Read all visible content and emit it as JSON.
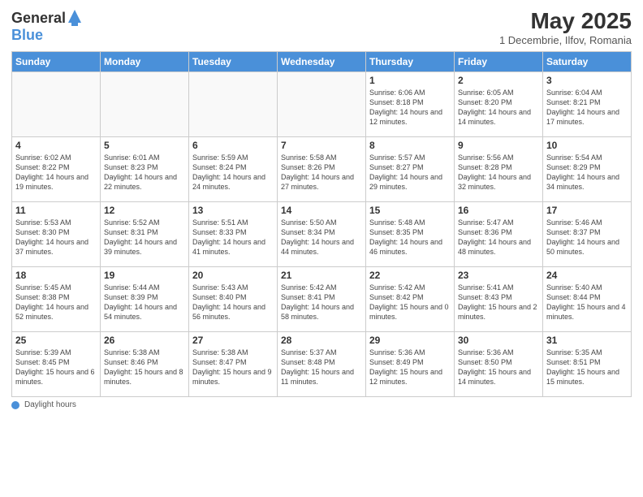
{
  "header": {
    "logo_general": "General",
    "logo_blue": "Blue",
    "month_title": "May 2025",
    "subtitle": "1 Decembrie, Ilfov, Romania"
  },
  "footer": {
    "label": "Daylight hours"
  },
  "columns": [
    "Sunday",
    "Monday",
    "Tuesday",
    "Wednesday",
    "Thursday",
    "Friday",
    "Saturday"
  ],
  "rows": [
    [
      {
        "day": "",
        "info": ""
      },
      {
        "day": "",
        "info": ""
      },
      {
        "day": "",
        "info": ""
      },
      {
        "day": "",
        "info": ""
      },
      {
        "day": "1",
        "info": "Sunrise: 6:06 AM\nSunset: 8:18 PM\nDaylight: 14 hours\nand 12 minutes."
      },
      {
        "day": "2",
        "info": "Sunrise: 6:05 AM\nSunset: 8:20 PM\nDaylight: 14 hours\nand 14 minutes."
      },
      {
        "day": "3",
        "info": "Sunrise: 6:04 AM\nSunset: 8:21 PM\nDaylight: 14 hours\nand 17 minutes."
      }
    ],
    [
      {
        "day": "4",
        "info": "Sunrise: 6:02 AM\nSunset: 8:22 PM\nDaylight: 14 hours\nand 19 minutes."
      },
      {
        "day": "5",
        "info": "Sunrise: 6:01 AM\nSunset: 8:23 PM\nDaylight: 14 hours\nand 22 minutes."
      },
      {
        "day": "6",
        "info": "Sunrise: 5:59 AM\nSunset: 8:24 PM\nDaylight: 14 hours\nand 24 minutes."
      },
      {
        "day": "7",
        "info": "Sunrise: 5:58 AM\nSunset: 8:26 PM\nDaylight: 14 hours\nand 27 minutes."
      },
      {
        "day": "8",
        "info": "Sunrise: 5:57 AM\nSunset: 8:27 PM\nDaylight: 14 hours\nand 29 minutes."
      },
      {
        "day": "9",
        "info": "Sunrise: 5:56 AM\nSunset: 8:28 PM\nDaylight: 14 hours\nand 32 minutes."
      },
      {
        "day": "10",
        "info": "Sunrise: 5:54 AM\nSunset: 8:29 PM\nDaylight: 14 hours\nand 34 minutes."
      }
    ],
    [
      {
        "day": "11",
        "info": "Sunrise: 5:53 AM\nSunset: 8:30 PM\nDaylight: 14 hours\nand 37 minutes."
      },
      {
        "day": "12",
        "info": "Sunrise: 5:52 AM\nSunset: 8:31 PM\nDaylight: 14 hours\nand 39 minutes."
      },
      {
        "day": "13",
        "info": "Sunrise: 5:51 AM\nSunset: 8:33 PM\nDaylight: 14 hours\nand 41 minutes."
      },
      {
        "day": "14",
        "info": "Sunrise: 5:50 AM\nSunset: 8:34 PM\nDaylight: 14 hours\nand 44 minutes."
      },
      {
        "day": "15",
        "info": "Sunrise: 5:48 AM\nSunset: 8:35 PM\nDaylight: 14 hours\nand 46 minutes."
      },
      {
        "day": "16",
        "info": "Sunrise: 5:47 AM\nSunset: 8:36 PM\nDaylight: 14 hours\nand 48 minutes."
      },
      {
        "day": "17",
        "info": "Sunrise: 5:46 AM\nSunset: 8:37 PM\nDaylight: 14 hours\nand 50 minutes."
      }
    ],
    [
      {
        "day": "18",
        "info": "Sunrise: 5:45 AM\nSunset: 8:38 PM\nDaylight: 14 hours\nand 52 minutes."
      },
      {
        "day": "19",
        "info": "Sunrise: 5:44 AM\nSunset: 8:39 PM\nDaylight: 14 hours\nand 54 minutes."
      },
      {
        "day": "20",
        "info": "Sunrise: 5:43 AM\nSunset: 8:40 PM\nDaylight: 14 hours\nand 56 minutes."
      },
      {
        "day": "21",
        "info": "Sunrise: 5:42 AM\nSunset: 8:41 PM\nDaylight: 14 hours\nand 58 minutes."
      },
      {
        "day": "22",
        "info": "Sunrise: 5:42 AM\nSunset: 8:42 PM\nDaylight: 15 hours\nand 0 minutes."
      },
      {
        "day": "23",
        "info": "Sunrise: 5:41 AM\nSunset: 8:43 PM\nDaylight: 15 hours\nand 2 minutes."
      },
      {
        "day": "24",
        "info": "Sunrise: 5:40 AM\nSunset: 8:44 PM\nDaylight: 15 hours\nand 4 minutes."
      }
    ],
    [
      {
        "day": "25",
        "info": "Sunrise: 5:39 AM\nSunset: 8:45 PM\nDaylight: 15 hours\nand 6 minutes."
      },
      {
        "day": "26",
        "info": "Sunrise: 5:38 AM\nSunset: 8:46 PM\nDaylight: 15 hours\nand 8 minutes."
      },
      {
        "day": "27",
        "info": "Sunrise: 5:38 AM\nSunset: 8:47 PM\nDaylight: 15 hours\nand 9 minutes."
      },
      {
        "day": "28",
        "info": "Sunrise: 5:37 AM\nSunset: 8:48 PM\nDaylight: 15 hours\nand 11 minutes."
      },
      {
        "day": "29",
        "info": "Sunrise: 5:36 AM\nSunset: 8:49 PM\nDaylight: 15 hours\nand 12 minutes."
      },
      {
        "day": "30",
        "info": "Sunrise: 5:36 AM\nSunset: 8:50 PM\nDaylight: 15 hours\nand 14 minutes."
      },
      {
        "day": "31",
        "info": "Sunrise: 5:35 AM\nSunset: 8:51 PM\nDaylight: 15 hours\nand 15 minutes."
      }
    ]
  ]
}
